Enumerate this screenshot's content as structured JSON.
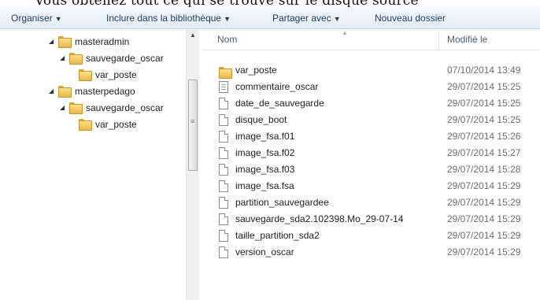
{
  "top_strip": {
    "text": "Vous obtenez tout ce qui se trouve sur le disque source"
  },
  "toolbar": {
    "organiser": "Organiser",
    "inclure": "Inclure dans la bibliothèque",
    "partager": "Partager avec",
    "nouveau": "Nouveau dossier"
  },
  "nav": {
    "items": [
      {
        "label": "masteradmin",
        "expanded": true
      },
      {
        "label": "sauvegarde_oscar",
        "expanded": true
      },
      {
        "label": "var_poste",
        "expanded": false
      },
      {
        "label": "masterpedago",
        "expanded": true
      },
      {
        "label": "sauvegarde_oscar",
        "expanded": true
      },
      {
        "label": "var_poste",
        "expanded": false
      }
    ]
  },
  "columns": {
    "name": "Nom",
    "modified": "Modifié le"
  },
  "files": [
    {
      "name": "var_poste",
      "date": "07/10/2014 13:49",
      "icon": "folder-icon"
    },
    {
      "name": "commentaire_oscar",
      "date": "29/07/2014 15:25",
      "icon": "text-file-icon"
    },
    {
      "name": "date_de_sauvegarde",
      "date": "29/07/2014 15:25",
      "icon": "file-icon"
    },
    {
      "name": "disque_boot",
      "date": "29/07/2014 15:25",
      "icon": "file-icon"
    },
    {
      "name": "image_fsa.f01",
      "date": "29/07/2014 15:26",
      "icon": "file-icon"
    },
    {
      "name": "image_fsa.f02",
      "date": "29/07/2014 15:27",
      "icon": "file-icon"
    },
    {
      "name": "image_fsa.f03",
      "date": "29/07/2014 15:28",
      "icon": "file-icon"
    },
    {
      "name": "image_fsa.fsa",
      "date": "29/07/2014 15:29",
      "icon": "file-icon"
    },
    {
      "name": "partition_sauvegardee",
      "date": "29/07/2014 15:29",
      "icon": "file-icon"
    },
    {
      "name": "sauvegarde_sda2.102398.Mo_29-07-14",
      "date": "29/07/2014 15:29",
      "icon": "file-icon"
    },
    {
      "name": "taille_partition_sda2",
      "date": "29/07/2014 15:29",
      "icon": "file-icon"
    },
    {
      "name": "version_oscar",
      "date": "29/07/2014 15:29",
      "icon": "file-icon"
    }
  ]
}
